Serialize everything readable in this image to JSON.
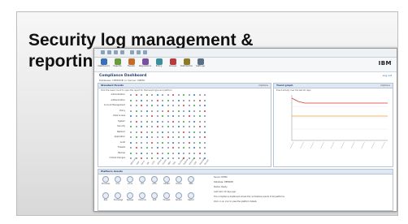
{
  "slide": {
    "title": "Security log management & reporting"
  },
  "app": {
    "brand": "IBM",
    "brand_sub": "",
    "toolbar_buttons": [
      {
        "label": "Dashboard",
        "color": "#3b6fb5"
      },
      {
        "label": "Reports",
        "color": "#6a9a3a"
      },
      {
        "label": "Events",
        "color": "#c46b2a"
      },
      {
        "label": "Regulations",
        "color": "#7a4fa0"
      },
      {
        "label": "Policy",
        "color": "#3a8f9a"
      },
      {
        "label": "Groups",
        "color": "#b83a3a"
      },
      {
        "label": "Distribution",
        "color": "#8a7a2a"
      },
      {
        "label": "Settings",
        "color": "#5a6f86"
      }
    ],
    "dashboard_title": "Compliance Dashboard",
    "dashboard_subtitle": "Database: DEMODB on Server: DEMO",
    "logout_label": "Log out",
    "left_panel": {
      "header": "Standard Events",
      "option": "Options",
      "note": "Click the event count to open the report for that event type and platform",
      "rows": [
        "Administration",
        "Authentication",
        "Account Management",
        "Policy",
        "Data Access",
        "System",
        "Security",
        "Network",
        "Application",
        "Audit",
        "Firewall",
        "Backup",
        "Critical Changes"
      ],
      "columns": [
        "Windows",
        "Unix",
        "Linux",
        "AIX",
        "z/OS",
        "AS400",
        "Oracle",
        "DB2",
        "SQL",
        "Exchange",
        "Sybase",
        "Informix",
        "SAP",
        "Firewall",
        "Router"
      ]
    },
    "right_panel": {
      "header": "Trend graph",
      "option": "Options",
      "note": "Event activity over the last 20 days"
    },
    "bottom_panel": {
      "header": "Platform Assets",
      "icons": [
        "Windows",
        "Unix",
        "Linux",
        "AIX",
        "z/OS",
        "AS400",
        "Oracle",
        "DB2",
        "SQL",
        "Exchange",
        "Sybase",
        "Informix",
        "SAP",
        "Firewall",
        "Router",
        "Switch"
      ],
      "info": [
        "Server: DEMO",
        "Database: DEMODB",
        "Status: Ready",
        "Last load: 20 days ago",
        "The compliance dashboard shows the normalized events of all platforms",
        "Click on an icon to view the platform details"
      ]
    }
  }
}
